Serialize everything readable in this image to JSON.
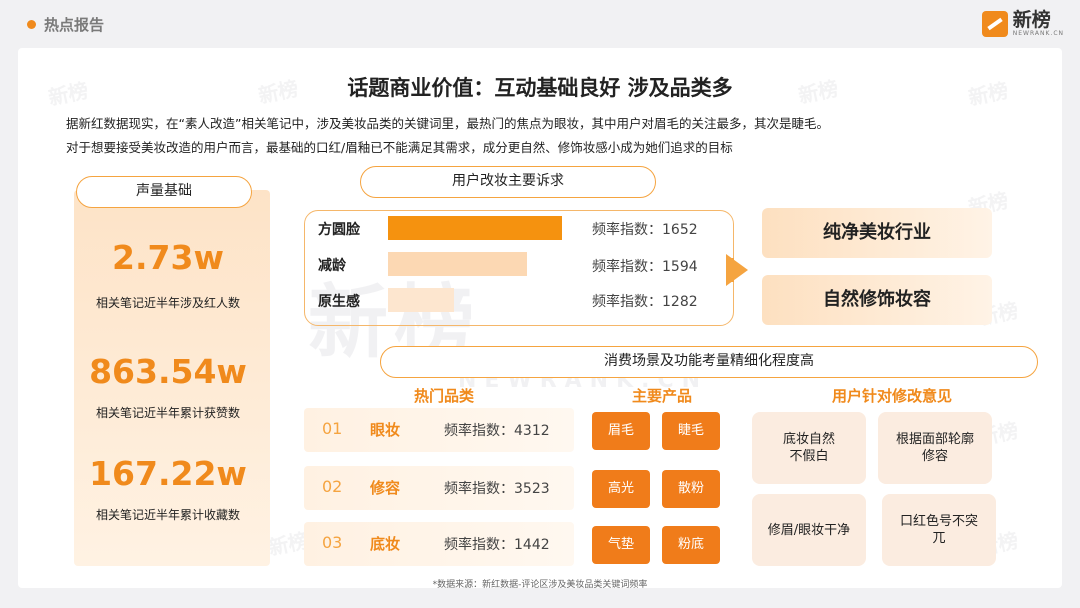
{
  "header": {
    "section_title": "热点报告",
    "brand_name": "新榜",
    "brand_sub": "NEWRANK.CN"
  },
  "title": "话题商业价值：互动基础良好 涉及品类多",
  "description": [
    "据新红数据现实，在“素人改造”相关笔记中，涉及美妆品类的关键词里，最热门的焦点为眼妆，其中用户对眉毛的关注最多，其次是睫毛。",
    "对于想要接受美妆改造的用户而言，最基础的口红/眉釉已不能满足其需求，成分更自然、修饰妆感小成为她们追求的目标"
  ],
  "volume": {
    "title": "声量基础",
    "metrics": [
      {
        "value": "2.73w",
        "label": "相关笔记近半年涉及红人数"
      },
      {
        "value": "863.54w",
        "label": "相关笔记近半年累计获赞数"
      },
      {
        "value": "167.22w",
        "label": "相关笔记近半年累计收藏数"
      }
    ]
  },
  "requests": {
    "title": "用户改妆主要诉求",
    "items": [
      {
        "name": "方圆脸",
        "freq_text": "频率指数：1652",
        "value": 1652,
        "color": "#f5920f"
      },
      {
        "name": "减龄",
        "freq_text": "频率指数：1594",
        "value": 1594,
        "color": "#fcd8b3"
      },
      {
        "name": "原生感",
        "freq_text": "频率指数：1282",
        "value": 1282,
        "color": "#fde6cf"
      }
    ],
    "results": [
      "纯净美妆行业",
      "自然修饰妆容"
    ]
  },
  "scenarios": {
    "title": "消费场景及功能考量精细化程度高",
    "categories_title": "热门品类",
    "categories": [
      {
        "num": "01",
        "name": "眼妆",
        "freq": "频率指数：4312"
      },
      {
        "num": "02",
        "name": "修容",
        "freq": "频率指数：3523"
      },
      {
        "num": "03",
        "name": "底妆",
        "freq": "频率指数：1442"
      }
    ],
    "products_title": "主要产品",
    "products": [
      "眉毛",
      "睫毛",
      "高光",
      "散粉",
      "气垫",
      "粉底"
    ],
    "opinions_title": "用户针对修改意见",
    "opinions": [
      "底妆自然\n不假白",
      "根据面部轮廓\n修容",
      "修眉/眼妆干净",
      "口红色号不突\n兀"
    ]
  },
  "footnote": "*数据来源：新红数据-评论区涉及美妆品类关键词频率",
  "watermark": "新榜"
}
